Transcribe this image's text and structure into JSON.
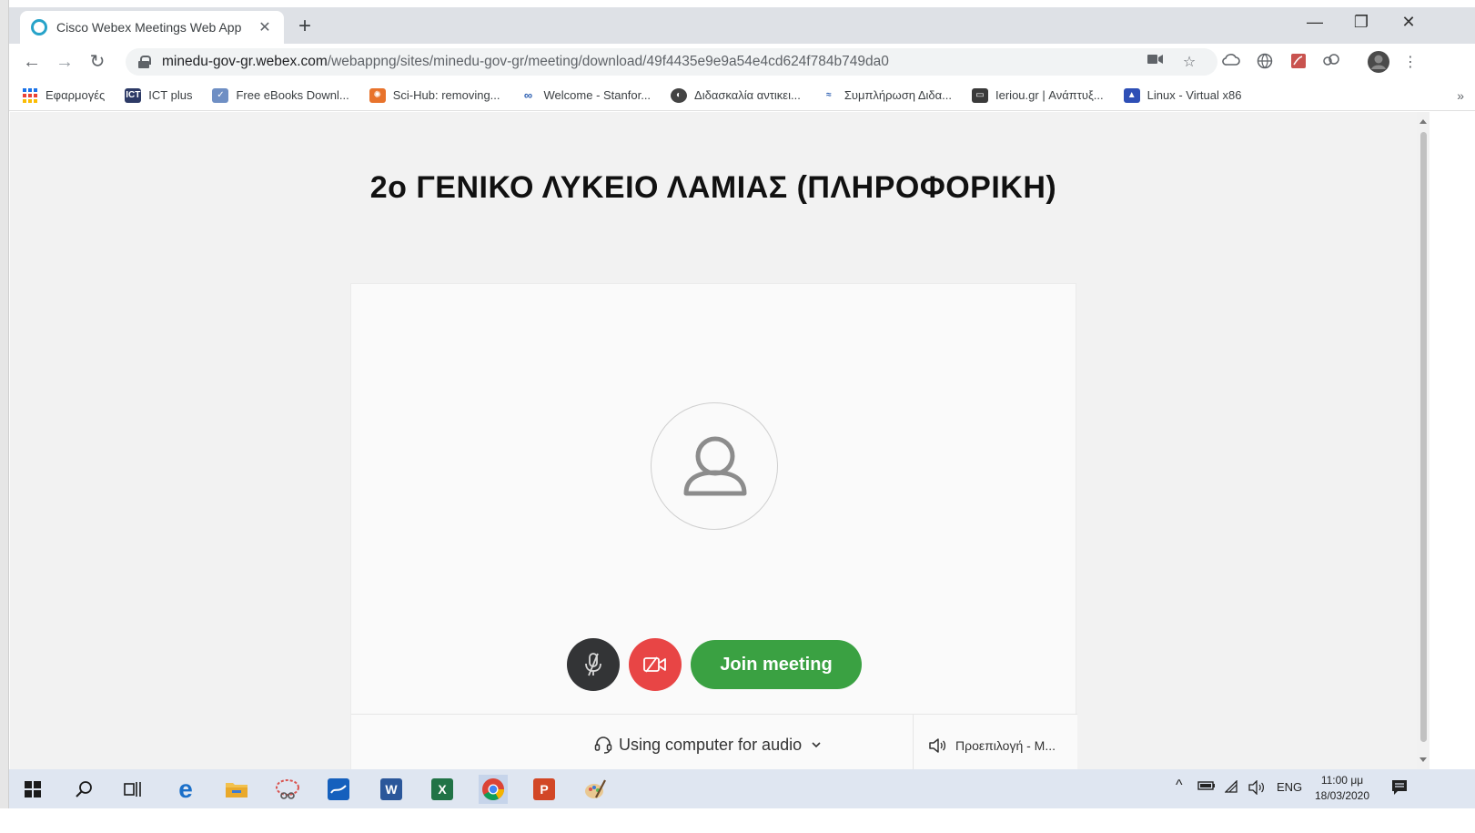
{
  "browser": {
    "tab_title": "Cisco Webex Meetings Web App",
    "tab_close": "✕",
    "new_tab": "+",
    "url_host": "minedu-gov-gr.webex.com",
    "url_path": "/webappng/sites/minedu-gov-gr/meeting/download/49f4435e9e9a54e4cd624f784b749da0",
    "bookmarks": [
      {
        "label": "Εφαρμογές",
        "icon": "apps-grid-icon"
      },
      {
        "label": "ICT plus",
        "icon": "ict-icon"
      },
      {
        "label": "Free eBooks Downl...",
        "icon": "ebooks-icon"
      },
      {
        "label": "Sci-Hub: removing...",
        "icon": "scihub-icon"
      },
      {
        "label": "Welcome - Stanfor...",
        "icon": "stanford-icon"
      },
      {
        "label": "Διδασκαλία αντικει...",
        "icon": "globe-icon"
      },
      {
        "label": "Συμπλήρωση Διδα...",
        "icon": "site-icon"
      },
      {
        "label": "Ieriou.gr | Ανάπτυξ...",
        "icon": "monitor-icon"
      },
      {
        "label": "Linux - Virtual x86",
        "icon": "linux-icon"
      }
    ],
    "bookmarks_more": "»"
  },
  "meeting": {
    "title": "2ο ΓΕΝΙΚΟ ΛΥΚΕΙΟ ΛΑΜΙΑΣ  (ΠΛΗΡΟΦΟΡΙΚΗ)",
    "join_label": "Join meeting",
    "audio_option": "Using computer for audio",
    "speaker_option": "Προεπιλογή - M...",
    "colors": {
      "join": "#3aa142",
      "video_off": "#e84545",
      "mute": "#333436"
    }
  },
  "taskbar": {
    "language": "ENG",
    "time": "11:00 μμ",
    "date": "18/03/2020"
  }
}
